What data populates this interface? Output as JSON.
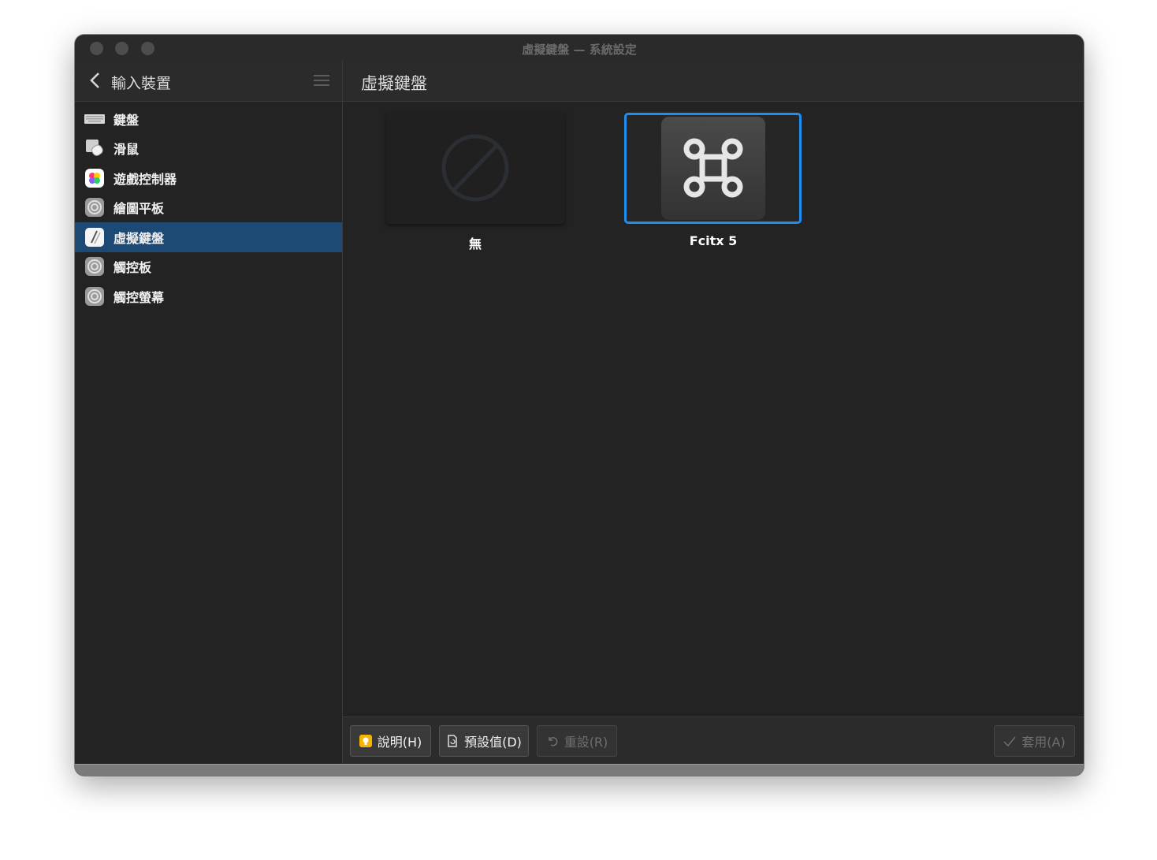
{
  "window": {
    "title": "虛擬鍵盤 — 系統設定"
  },
  "sidebar": {
    "header_title": "輸入裝置",
    "items": [
      {
        "label": "鍵盤",
        "icon": "keyboard-icon",
        "active": false
      },
      {
        "label": "滑鼠",
        "icon": "mouse-icon",
        "active": false
      },
      {
        "label": "遊戲控制器",
        "icon": "game-controller-icon",
        "active": false
      },
      {
        "label": "繪圖平板",
        "icon": "settings-gear-icon",
        "active": false
      },
      {
        "label": "虛擬鍵盤",
        "icon": "virtual-keyboard-icon",
        "active": true
      },
      {
        "label": "觸控板",
        "icon": "settings-gear-icon",
        "active": false
      },
      {
        "label": "觸控螢幕",
        "icon": "settings-gear-icon",
        "active": false
      }
    ]
  },
  "main": {
    "title": "虛擬鍵盤",
    "options": [
      {
        "label": "無",
        "icon": "none-icon",
        "selected": false
      },
      {
        "label": "Fcitx 5",
        "icon": "command-key-icon",
        "selected": true
      }
    ]
  },
  "footer": {
    "help": "說明(H)",
    "defaults": "預設值(D)",
    "reset": "重設(R)",
    "apply": "套用(A)"
  },
  "colors": {
    "accent": "#1e8ef0",
    "selection": "#1d4a75",
    "background": "#232323"
  }
}
